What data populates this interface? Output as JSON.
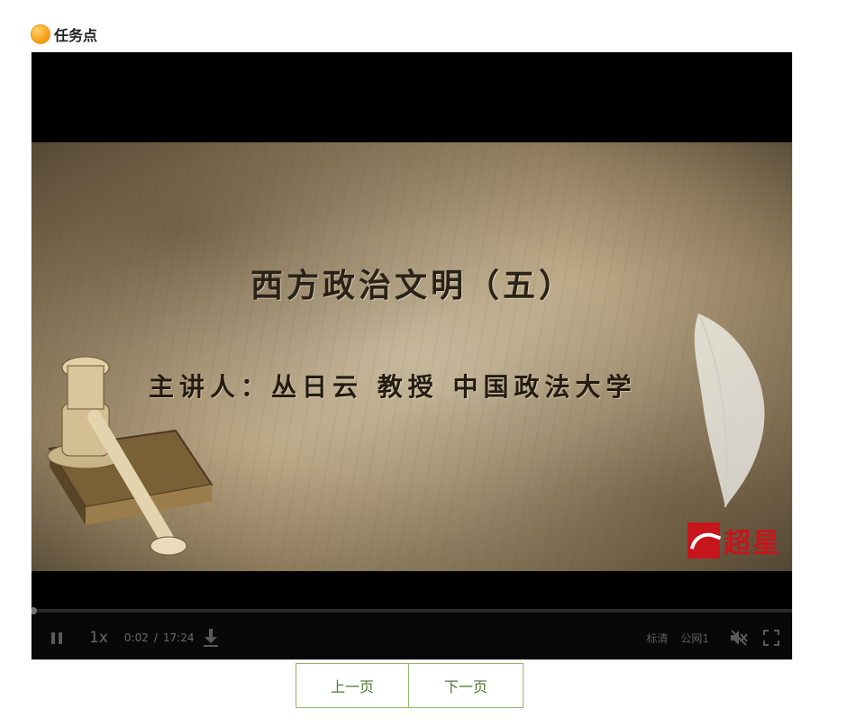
{
  "task": {
    "title": "任务点"
  },
  "video": {
    "slide_title": "西方政治文明（五）",
    "slide_subtitle": "主讲人：丛日云 教授 中国政法大学",
    "brand_text": "超星",
    "progress": 0.002
  },
  "controls": {
    "speed": "1x",
    "current_time": "0:02",
    "separator": "/",
    "total_time": "17:24",
    "quality": "标清",
    "line": "公网1"
  },
  "pager": {
    "prev_label": "上一页",
    "next_label": "下一页"
  },
  "colors": {
    "accent": "#f7a21a",
    "pager_border": "#8fb86a",
    "pager_text": "#4f7a33",
    "brand_red": "#c8151b"
  }
}
